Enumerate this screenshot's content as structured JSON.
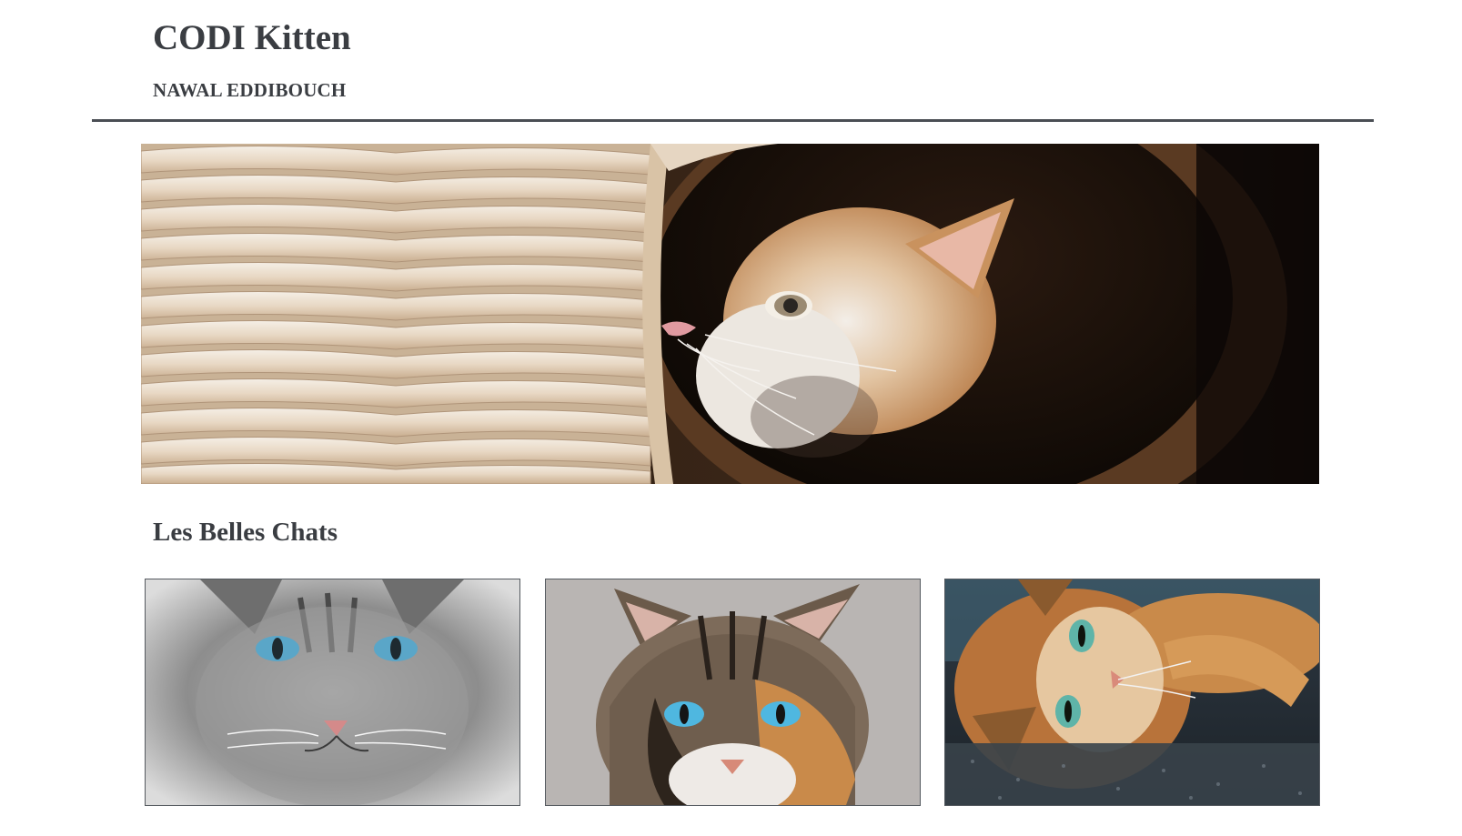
{
  "header": {
    "title": "CODI Kitten",
    "author": "NAWAL EDDIBOUCH"
  },
  "hero": {
    "image_icon": "kitten-in-basket-image"
  },
  "gallery": {
    "title": "Les Belles Chats",
    "items": [
      {
        "image_icon": "gray-cat-image"
      },
      {
        "image_icon": "calico-cat-image"
      },
      {
        "image_icon": "orange-cat-image"
      }
    ]
  },
  "colors": {
    "text": "#3a3d42",
    "rule": "#4a4e54",
    "background": "#ffffff"
  }
}
